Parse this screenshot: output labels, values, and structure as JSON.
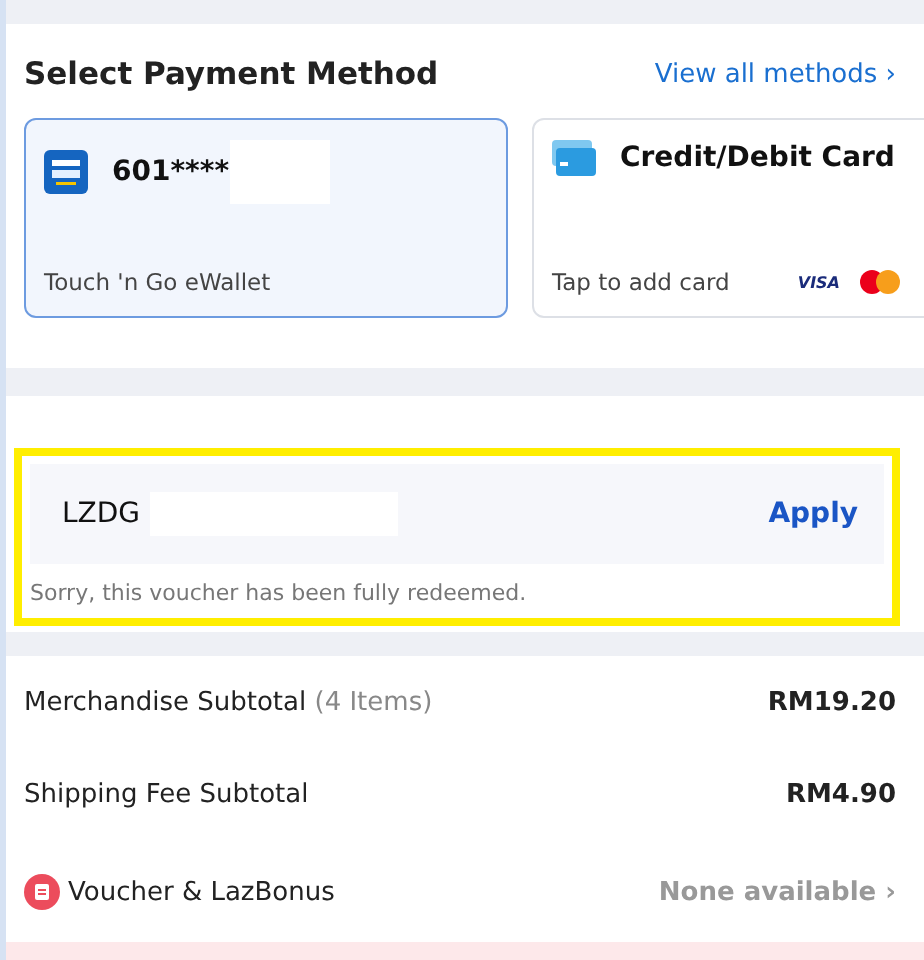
{
  "payment": {
    "title": "Select Payment Method",
    "view_all": "View all methods ›",
    "methods": [
      {
        "kind": "ewallet",
        "name": "601****",
        "redacted": true,
        "subtitle": "Touch 'n Go eWallet",
        "selected": true
      },
      {
        "kind": "card",
        "name": "Credit/Debit Card",
        "subtitle": "Tap to add card",
        "brand": "VISA",
        "selected": false
      }
    ]
  },
  "voucher": {
    "highlighted": true,
    "value": "LZDG",
    "redacted": true,
    "button": "Apply",
    "error": "Sorry, this voucher has been fully redeemed."
  },
  "summary": [
    {
      "kind": "line",
      "label": "Merchandise Subtotal",
      "note": "(4 Items)",
      "value": "RM19.20"
    },
    {
      "kind": "line",
      "label": "Shipping Fee Subtotal",
      "value": "RM4.90"
    },
    {
      "kind": "link",
      "label": "Voucher & LazBonus",
      "value": "None available ›"
    }
  ]
}
